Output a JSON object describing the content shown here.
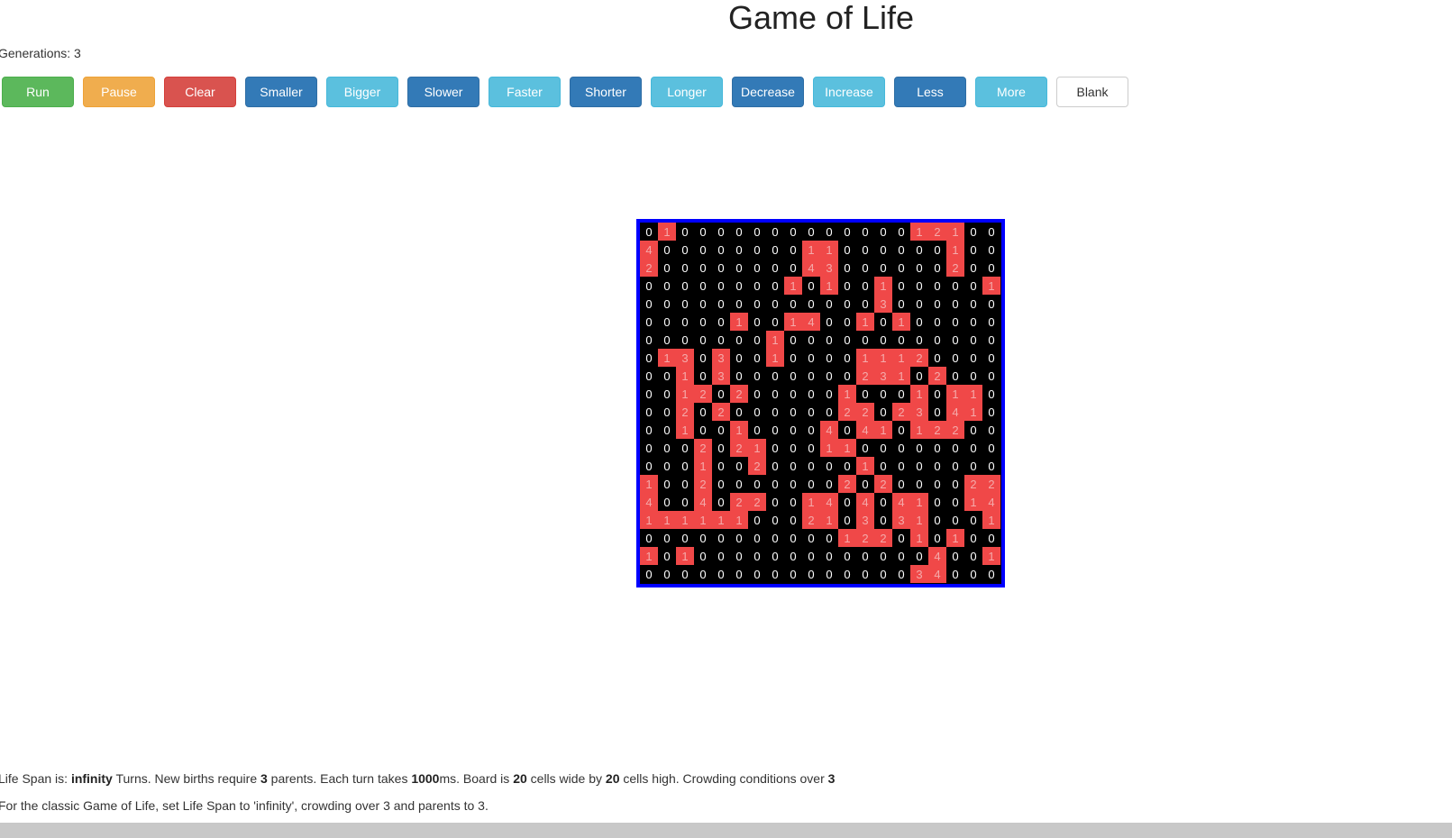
{
  "title": "Game of Life",
  "generations": "Generations: 3",
  "buttons": [
    {
      "label": "Run",
      "style": "success"
    },
    {
      "label": "Pause",
      "style": "warning"
    },
    {
      "label": "Clear",
      "style": "danger"
    },
    {
      "label": "Smaller",
      "style": "primary"
    },
    {
      "label": "Bigger",
      "style": "info"
    },
    {
      "label": "Slower",
      "style": "primary"
    },
    {
      "label": "Faster",
      "style": "info"
    },
    {
      "label": "Shorter",
      "style": "primary"
    },
    {
      "label": "Longer",
      "style": "info"
    },
    {
      "label": "Decrease",
      "style": "primary"
    },
    {
      "label": "Increase",
      "style": "info"
    },
    {
      "label": "Less",
      "style": "primary"
    },
    {
      "label": "More",
      "style": "info"
    },
    {
      "label": "Blank",
      "style": "default"
    }
  ],
  "colors": {
    "board_border": "#0000ff",
    "dead_cell": "#000000",
    "alive_cell": "#f04848"
  },
  "board": {
    "cols": 20,
    "rows": 20,
    "values": [
      [
        0,
        1,
        0,
        0,
        0,
        0,
        0,
        0,
        0,
        0,
        0,
        0,
        0,
        0,
        0,
        1,
        2,
        1,
        0,
        0
      ],
      [
        4,
        0,
        0,
        0,
        0,
        0,
        0,
        0,
        0,
        1,
        1,
        0,
        0,
        0,
        0,
        0,
        0,
        1,
        0,
        0
      ],
      [
        2,
        0,
        0,
        0,
        0,
        0,
        0,
        0,
        0,
        4,
        3,
        0,
        0,
        0,
        0,
        0,
        0,
        2,
        0,
        0
      ],
      [
        0,
        0,
        0,
        0,
        0,
        0,
        0,
        0,
        1,
        0,
        1,
        0,
        0,
        1,
        0,
        0,
        0,
        0,
        0,
        1
      ],
      [
        0,
        0,
        0,
        0,
        0,
        0,
        0,
        0,
        0,
        0,
        0,
        0,
        0,
        3,
        0,
        0,
        0,
        0,
        0,
        0
      ],
      [
        0,
        0,
        0,
        0,
        0,
        1,
        0,
        0,
        1,
        4,
        0,
        0,
        1,
        0,
        1,
        0,
        0,
        0,
        0,
        0
      ],
      [
        0,
        0,
        0,
        0,
        0,
        0,
        0,
        1,
        0,
        0,
        0,
        0,
        0,
        0,
        0,
        0,
        0,
        0,
        0,
        0
      ],
      [
        0,
        1,
        3,
        0,
        3,
        0,
        0,
        1,
        0,
        0,
        0,
        0,
        1,
        1,
        1,
        2,
        0,
        0,
        0,
        0
      ],
      [
        0,
        0,
        1,
        0,
        3,
        0,
        0,
        0,
        0,
        0,
        0,
        0,
        2,
        3,
        1,
        0,
        2,
        0,
        0,
        0
      ],
      [
        0,
        0,
        1,
        2,
        0,
        2,
        0,
        0,
        0,
        0,
        0,
        1,
        0,
        0,
        0,
        1,
        0,
        1,
        1,
        0
      ],
      [
        0,
        0,
        2,
        0,
        2,
        0,
        0,
        0,
        0,
        0,
        0,
        2,
        2,
        0,
        2,
        3,
        0,
        4,
        1,
        0
      ],
      [
        0,
        0,
        1,
        0,
        0,
        1,
        0,
        0,
        0,
        0,
        4,
        0,
        4,
        1,
        0,
        1,
        2,
        2,
        0,
        0
      ],
      [
        0,
        0,
        0,
        2,
        0,
        2,
        1,
        0,
        0,
        0,
        1,
        1,
        0,
        0,
        0,
        0,
        0,
        0,
        0,
        0
      ],
      [
        0,
        0,
        0,
        1,
        0,
        0,
        2,
        0,
        0,
        0,
        0,
        0,
        1,
        0,
        0,
        0,
        0,
        0,
        0,
        0
      ],
      [
        1,
        0,
        0,
        2,
        0,
        0,
        0,
        0,
        0,
        0,
        0,
        2,
        0,
        2,
        0,
        0,
        0,
        0,
        2,
        2
      ],
      [
        4,
        0,
        0,
        4,
        0,
        2,
        2,
        0,
        0,
        1,
        4,
        0,
        4,
        0,
        4,
        1,
        0,
        0,
        1,
        4
      ],
      [
        1,
        1,
        1,
        1,
        1,
        1,
        0,
        0,
        0,
        2,
        1,
        0,
        3,
        0,
        3,
        1,
        0,
        0,
        0,
        1
      ],
      [
        0,
        0,
        0,
        0,
        0,
        0,
        0,
        0,
        0,
        0,
        0,
        1,
        2,
        2,
        0,
        1,
        0,
        1,
        0,
        0
      ],
      [
        1,
        0,
        1,
        0,
        0,
        0,
        0,
        0,
        0,
        0,
        0,
        0,
        0,
        0,
        0,
        0,
        4,
        0,
        0,
        1
      ],
      [
        0,
        0,
        0,
        0,
        0,
        0,
        0,
        0,
        0,
        0,
        0,
        0,
        0,
        0,
        0,
        3,
        4,
        0,
        0,
        0
      ]
    ],
    "alive": [
      [
        0,
        1,
        0,
        0,
        0,
        0,
        0,
        0,
        0,
        0,
        0,
        0,
        0,
        0,
        0,
        1,
        1,
        1,
        0,
        0
      ],
      [
        1,
        0,
        0,
        0,
        0,
        0,
        0,
        0,
        0,
        1,
        1,
        0,
        0,
        0,
        0,
        0,
        0,
        1,
        0,
        0
      ],
      [
        1,
        0,
        0,
        0,
        0,
        0,
        0,
        0,
        0,
        1,
        1,
        0,
        0,
        0,
        0,
        0,
        0,
        1,
        0,
        0
      ],
      [
        0,
        0,
        0,
        0,
        0,
        0,
        0,
        0,
        1,
        0,
        1,
        0,
        0,
        1,
        0,
        0,
        0,
        0,
        0,
        1
      ],
      [
        0,
        0,
        0,
        0,
        0,
        0,
        0,
        0,
        0,
        0,
        0,
        0,
        0,
        1,
        0,
        0,
        0,
        0,
        0,
        0
      ],
      [
        0,
        0,
        0,
        0,
        0,
        1,
        0,
        0,
        1,
        1,
        0,
        0,
        1,
        0,
        1,
        0,
        0,
        0,
        0,
        0
      ],
      [
        0,
        0,
        0,
        0,
        0,
        0,
        0,
        1,
        0,
        0,
        0,
        0,
        0,
        0,
        0,
        0,
        0,
        0,
        0,
        0
      ],
      [
        0,
        1,
        1,
        0,
        1,
        0,
        0,
        1,
        0,
        0,
        0,
        0,
        1,
        1,
        1,
        1,
        0,
        0,
        0,
        0
      ],
      [
        0,
        0,
        1,
        0,
        1,
        0,
        0,
        0,
        0,
        0,
        0,
        0,
        1,
        1,
        1,
        0,
        1,
        0,
        0,
        0
      ],
      [
        0,
        0,
        1,
        1,
        0,
        1,
        0,
        0,
        0,
        0,
        0,
        1,
        0,
        0,
        0,
        1,
        0,
        1,
        1,
        0
      ],
      [
        0,
        0,
        1,
        0,
        1,
        0,
        0,
        0,
        0,
        0,
        0,
        1,
        1,
        0,
        1,
        1,
        0,
        1,
        1,
        0
      ],
      [
        0,
        0,
        1,
        0,
        0,
        1,
        0,
        0,
        0,
        0,
        1,
        0,
        1,
        1,
        0,
        1,
        1,
        1,
        0,
        0
      ],
      [
        0,
        0,
        0,
        1,
        0,
        1,
        1,
        0,
        0,
        0,
        1,
        1,
        0,
        0,
        0,
        0,
        0,
        0,
        0,
        0
      ],
      [
        0,
        0,
        0,
        1,
        0,
        0,
        1,
        0,
        0,
        0,
        0,
        0,
        1,
        0,
        0,
        0,
        0,
        0,
        0,
        0
      ],
      [
        1,
        0,
        0,
        1,
        0,
        0,
        0,
        0,
        0,
        0,
        0,
        1,
        0,
        1,
        0,
        0,
        0,
        0,
        1,
        1
      ],
      [
        1,
        0,
        0,
        1,
        0,
        1,
        1,
        0,
        0,
        1,
        1,
        0,
        1,
        0,
        1,
        1,
        0,
        0,
        1,
        1
      ],
      [
        1,
        1,
        1,
        1,
        1,
        1,
        0,
        0,
        0,
        1,
        1,
        0,
        1,
        0,
        1,
        1,
        0,
        0,
        0,
        1
      ],
      [
        0,
        0,
        0,
        0,
        0,
        0,
        0,
        0,
        0,
        0,
        0,
        1,
        1,
        1,
        0,
        1,
        0,
        1,
        0,
        0
      ],
      [
        1,
        0,
        1,
        0,
        0,
        0,
        0,
        0,
        0,
        0,
        0,
        0,
        0,
        0,
        0,
        0,
        1,
        0,
        0,
        1
      ],
      [
        0,
        0,
        0,
        0,
        0,
        0,
        0,
        0,
        0,
        0,
        0,
        0,
        0,
        0,
        0,
        1,
        1,
        0,
        0,
        0
      ]
    ]
  },
  "info": {
    "lifespan_prefix": "Life Span is: ",
    "lifespan_value": "infinity",
    "births_prefix": " Turns. New births require ",
    "parents_value": "3",
    "turn_prefix": " parents. Each turn takes ",
    "turn_value": "1000",
    "board_prefix": "ms. Board is ",
    "width_value": "20",
    "by_text": " cells wide by ",
    "height_value": "20",
    "crowding_prefix": " cells high. Crowding conditions over ",
    "crowding_value": "3",
    "classic_hint": "For the classic Game of Life, set Life Span to 'infinity', crowding over 3 and parents to 3."
  }
}
